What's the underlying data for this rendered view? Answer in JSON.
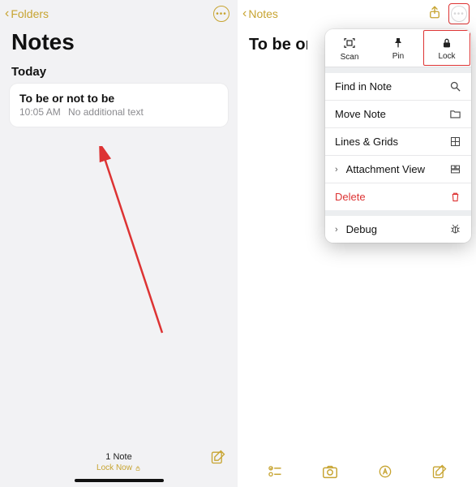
{
  "left": {
    "back_label": "Folders",
    "title": "Notes",
    "section": "Today",
    "note": {
      "title": "To be or not to be",
      "time": "10:05 AM",
      "snippet": "No additional text"
    },
    "footer_count": "1 Note",
    "lock_now": "Lock Now"
  },
  "right": {
    "back_label": "Notes",
    "note_title": "To be or",
    "top_actions": {
      "scan": "Scan",
      "pin": "Pin",
      "lock": "Lock"
    },
    "menu": {
      "find": "Find in Note",
      "move": "Move Note",
      "lines": "Lines & Grids",
      "attach": "Attachment View",
      "delete": "Delete",
      "debug": "Debug"
    }
  },
  "colors": {
    "accent": "#c7a431",
    "danger": "#d33"
  }
}
